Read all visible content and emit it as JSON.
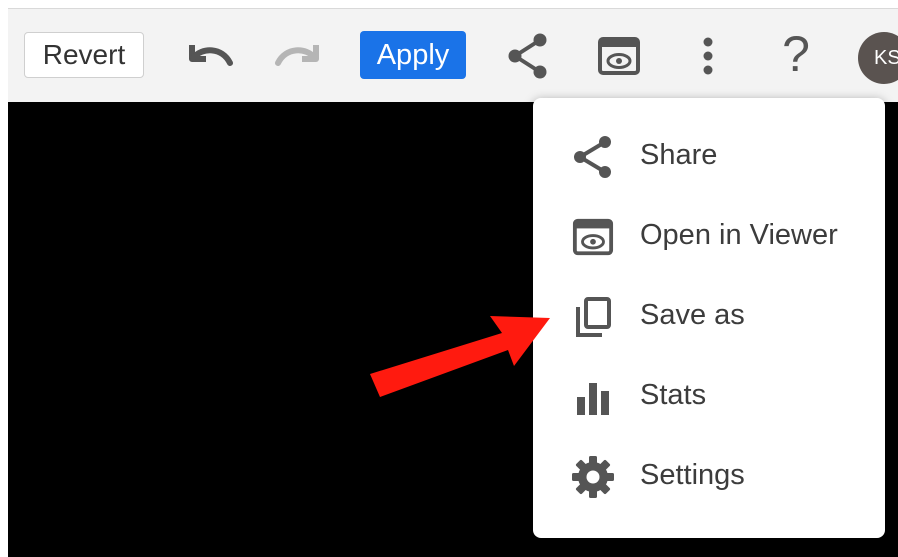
{
  "toolbar": {
    "revert_label": "Revert",
    "apply_label": "Apply",
    "help_glyph": "?",
    "avatar_initials": "KS",
    "icons": [
      "undo-icon",
      "redo-icon",
      "share-icon",
      "open-in-viewer-icon",
      "more-vert-icon",
      "help-icon"
    ]
  },
  "menu": {
    "items": [
      {
        "label": "Share",
        "icon": "share-icon"
      },
      {
        "label": "Open in Viewer",
        "icon": "open-in-viewer-icon"
      },
      {
        "label": "Save as",
        "icon": "copy-icon"
      },
      {
        "label": "Stats",
        "icon": "bar-chart-icon"
      },
      {
        "label": "Settings",
        "icon": "gear-icon"
      }
    ]
  },
  "colors": {
    "apply": "#1a73e8",
    "icon": "#555555",
    "icon_disabled": "#b5b5b5",
    "arrow": "#ff1a0f",
    "canvas": "#000000"
  }
}
